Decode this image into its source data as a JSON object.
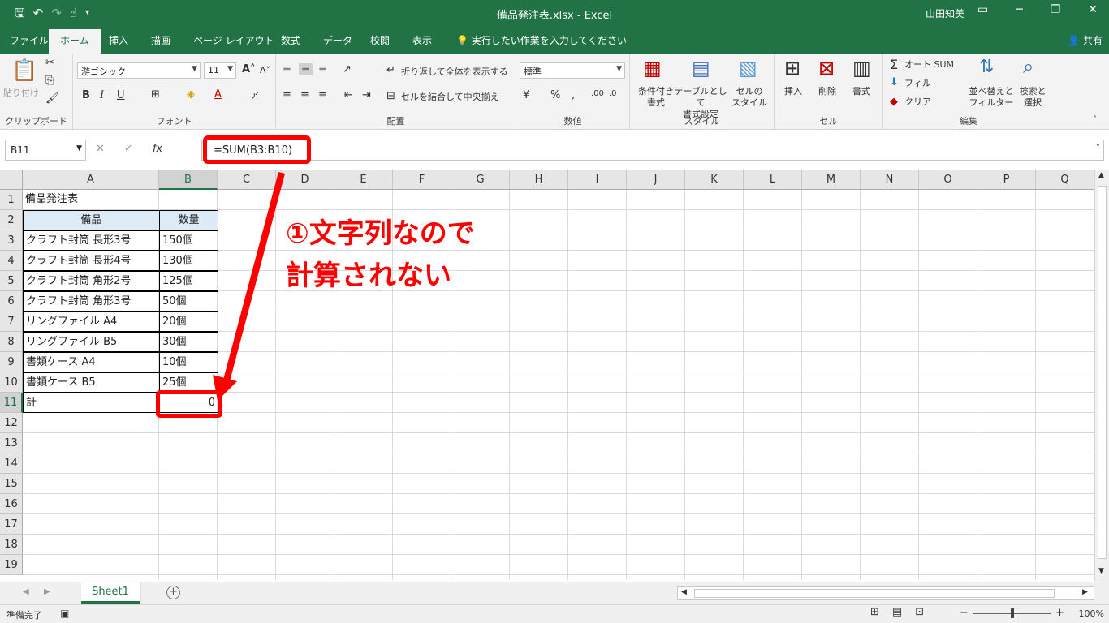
{
  "window": {
    "title": "備品発注表.xlsx  -  Excel",
    "user": "山田知美"
  },
  "tabs": [
    "ファイル",
    "ホーム",
    "挿入",
    "描画",
    "ページ レイアウト",
    "数式",
    "データ",
    "校閲",
    "表示"
  ],
  "tell_me": "実行したい作業を入力してください",
  "share": "共有",
  "ribbon": {
    "clipboard": {
      "paste": "貼り付け",
      "label": "クリップボード"
    },
    "font": {
      "name": "游ゴシック",
      "size": "11",
      "label": "フォント"
    },
    "alignment": {
      "wrap": "折り返して全体を表示する",
      "merge": "セルを結合して中央揃え",
      "label": "配置"
    },
    "number": {
      "format": "標準",
      "label": "数値"
    },
    "styles": {
      "conditional": "条件付き",
      "conditional2": "書式",
      "table": "テーブルとして",
      "table2": "書式設定",
      "cell": "セルの",
      "cell2": "スタイル",
      "label": "スタイル"
    },
    "cells": {
      "insert": "挿入",
      "delete": "削除",
      "format": "書式",
      "label": "セル"
    },
    "editing": {
      "autosum": "オート SUM",
      "fill": "フィル",
      "clear": "クリア",
      "sort": "並べ替えと",
      "sort2": "フィルター",
      "find": "検索と",
      "find2": "選択",
      "label": "編集"
    }
  },
  "formula_bar": {
    "name_box": "B11",
    "formula": "=SUM(B3:B10)"
  },
  "columns": [
    "A",
    "B",
    "C",
    "D",
    "E",
    "F",
    "G",
    "H",
    "I",
    "J",
    "K",
    "L",
    "M",
    "N",
    "O",
    "P",
    "Q"
  ],
  "rows": [
    "1",
    "2",
    "3",
    "4",
    "5",
    "6",
    "7",
    "8",
    "9",
    "10",
    "11",
    "12",
    "13",
    "14",
    "15",
    "16",
    "17",
    "18",
    "19"
  ],
  "sheet": {
    "title": "備品発注表",
    "header_item": "備品",
    "header_qty": "数量",
    "items": [
      {
        "name": "クラフト封筒 長形3号",
        "qty": "150個"
      },
      {
        "name": "クラフト封筒 長形4号",
        "qty": "130個"
      },
      {
        "name": "クラフト封筒 角形2号",
        "qty": "125個"
      },
      {
        "name": "クラフト封筒 角形3号",
        "qty": "50個"
      },
      {
        "name": "リングファイル A4",
        "qty": "20個"
      },
      {
        "name": "リングファイル B5",
        "qty": "30個"
      },
      {
        "name": "書類ケース A4",
        "qty": "10個"
      },
      {
        "name": "書類ケース B5",
        "qty": "25個"
      }
    ],
    "total_label": "計",
    "total_value": "0"
  },
  "annotation": {
    "line1": "①文字列なので",
    "line2": "計算されない",
    "color": "#ff0000"
  },
  "sheet_tab": "Sheet1",
  "status": {
    "text": "準備完了",
    "zoom": "100%"
  },
  "colors": {
    "accent": "#217346",
    "header_fill": "#ddebf7",
    "highlight": "#ff0000"
  }
}
